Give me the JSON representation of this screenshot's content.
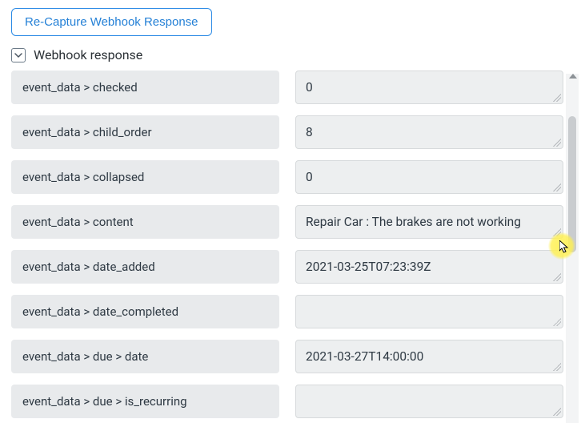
{
  "recapture_label": "Re-Capture Webhook Response",
  "section_title": "Webhook response",
  "rows": [
    {
      "key": "event_data > checked",
      "value": "0"
    },
    {
      "key": "event_data > child_order",
      "value": "8"
    },
    {
      "key": "event_data > collapsed",
      "value": "0"
    },
    {
      "key": "event_data > content",
      "value": "Repair Car : The brakes are not working"
    },
    {
      "key": "event_data > date_added",
      "value": "2021-03-25T07:23:39Z"
    },
    {
      "key": "event_data > date_completed",
      "value": ""
    },
    {
      "key": "event_data > due > date",
      "value": "2021-03-27T14:00:00"
    },
    {
      "key": "event_data > due > is_recurring",
      "value": ""
    }
  ]
}
